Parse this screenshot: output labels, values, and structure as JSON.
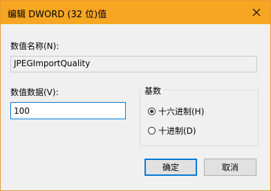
{
  "window": {
    "title": "编辑 DWORD (32 位)值",
    "close_icon": "close-icon"
  },
  "name_section": {
    "label": "数值名称(N):",
    "value": "JPEGImportQuality"
  },
  "data_section": {
    "label": "数值数据(V):",
    "value": "100"
  },
  "base_group": {
    "title": "基数",
    "options": [
      {
        "label": "十六进制(H)",
        "selected": true
      },
      {
        "label": "十进制(D)",
        "selected": false
      }
    ]
  },
  "buttons": {
    "ok_label": "确定",
    "cancel_label": "取消"
  },
  "colors": {
    "titlebar": "#f6a623",
    "focus_border": "#0078d7"
  }
}
